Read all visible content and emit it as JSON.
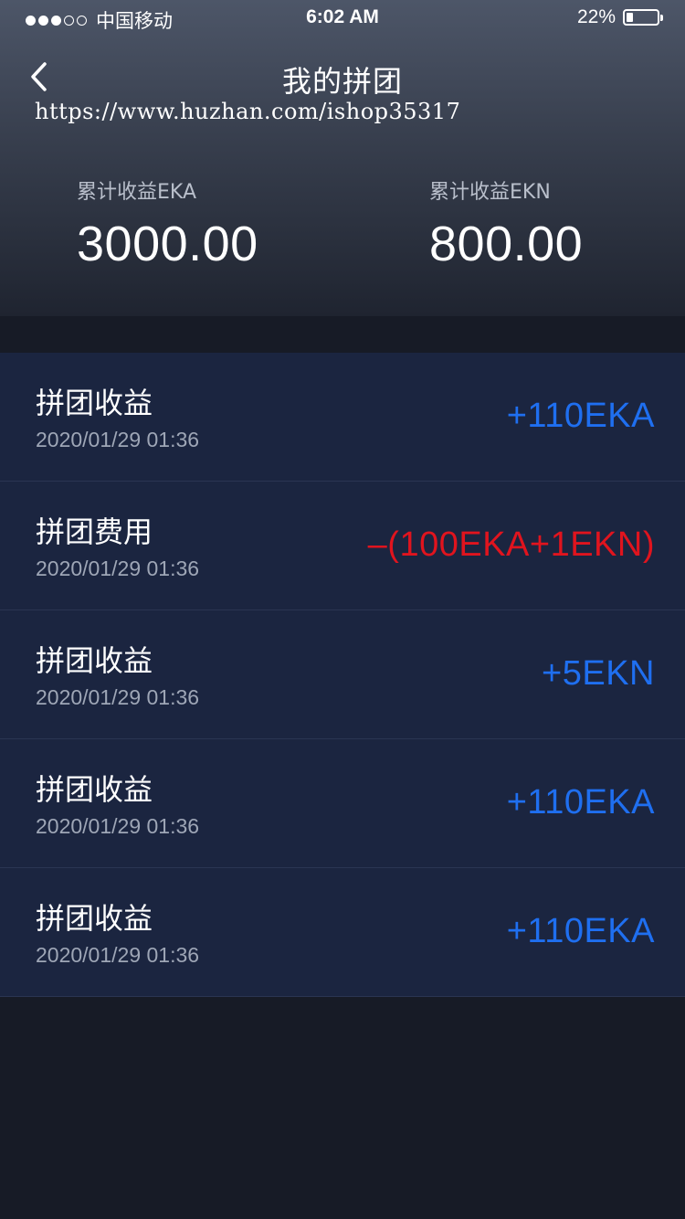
{
  "status_bar": {
    "carrier": "中国移动",
    "time": "6:02 AM",
    "battery": "22%",
    "battery_level": 0.22
  },
  "nav": {
    "title": "我的拼团",
    "back_icon": "chevron-left-icon"
  },
  "watermark": "https://www.huzhan.com/ishop35317",
  "stats": [
    {
      "label": "累计收益EKA",
      "value": "3000.00"
    },
    {
      "label": "累计收益EKN",
      "value": "800.00"
    }
  ],
  "records": [
    {
      "title": "拼团收益",
      "time": "2020/01/29 01:36",
      "amount": "+110EKA",
      "type": "income"
    },
    {
      "title": "拼团费用",
      "time": "2020/01/29 01:36",
      "amount": "–(100EKA+1EKN)",
      "type": "expense"
    },
    {
      "title": "拼团收益",
      "time": "2020/01/29 01:36",
      "amount": "+5EKN",
      "type": "income"
    },
    {
      "title": "拼团收益",
      "time": "2020/01/29 01:36",
      "amount": "+110EKA",
      "type": "income"
    },
    {
      "title": "拼团收益",
      "time": "2020/01/29 01:36",
      "amount": "+110EKA",
      "type": "income"
    }
  ],
  "colors": {
    "income": "#1f6ff0",
    "expense": "#e0141e",
    "list_background": "#1b2540",
    "page_background": "#171b26"
  }
}
